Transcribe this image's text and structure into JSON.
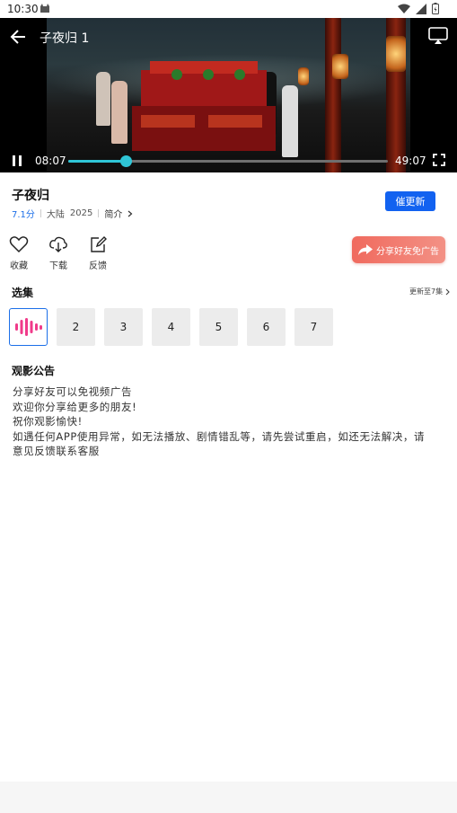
{
  "status_bar": {
    "time": "10:30"
  },
  "video": {
    "title": "子夜归 1",
    "current_time": "08:07",
    "total_time": "49:07",
    "progress": 0.18,
    "accent": "#2fc5d6"
  },
  "show": {
    "title": "子夜归",
    "score": "7.1分",
    "region": "大陆",
    "year": "2025",
    "intro_label": "简介",
    "urge_update_label": "催更新"
  },
  "actions": [
    {
      "icon": "heart-icon",
      "label": "收藏"
    },
    {
      "icon": "download-icon",
      "label": "下载"
    },
    {
      "icon": "edit-icon",
      "label": "反馈"
    }
  ],
  "share_label": "分享好友免广告",
  "episodes": {
    "section_title": "选集",
    "more_label": "更新至7集",
    "items": [
      "",
      "2",
      "3",
      "4",
      "5",
      "6",
      "7"
    ],
    "active_index": 0
  },
  "notice": {
    "title": "观影公告",
    "lines": [
      "分享好友可以免视频广告",
      "欢迎你分享给更多的朋友!",
      "祝你观影愉快!",
      "如遇任何APP使用异常，如无法播放、剧情错乱等，请先尝试重启，如还无法解决，请意见反馈联系客服"
    ]
  },
  "colors": {
    "primary": "#1262f0",
    "share_gradient_start": "#f06a5e",
    "equalizer": "#f03a8a"
  }
}
